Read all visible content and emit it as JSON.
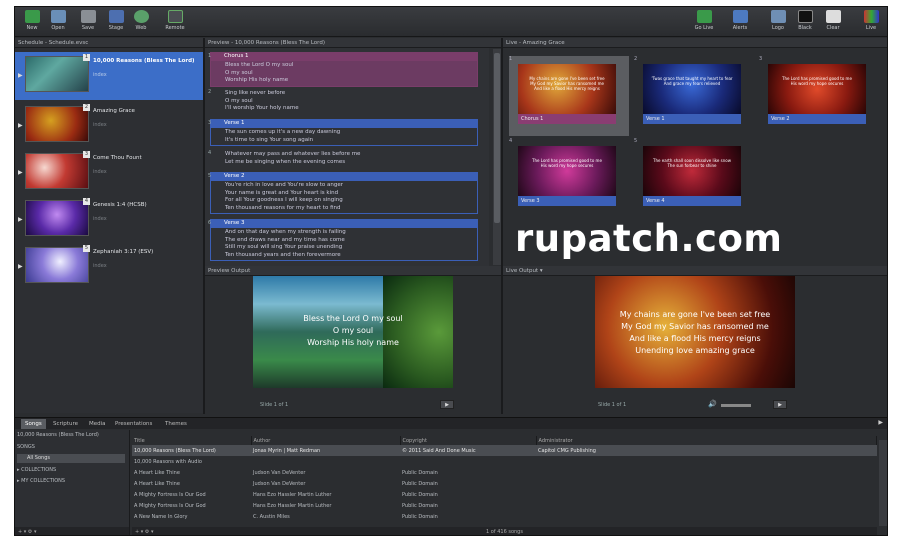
{
  "toolbar": {
    "buttons": [
      {
        "label": "New",
        "icon": "new-icon"
      },
      {
        "label": "Open",
        "icon": "open-icon"
      },
      {
        "label": "Save",
        "icon": "save-icon"
      },
      {
        "label": "Stage",
        "icon": "stage-icon"
      },
      {
        "label": "Web",
        "icon": "web-icon"
      },
      {
        "label": "Remote",
        "icon": "remote-icon"
      }
    ],
    "right": [
      {
        "label": "Go Live",
        "icon": "go-live-icon"
      },
      {
        "label": "Alerts",
        "icon": "alerts-icon"
      },
      {
        "label": "Logo",
        "icon": "logo-icon"
      },
      {
        "label": "Black",
        "icon": "black-icon"
      },
      {
        "label": "Clear",
        "icon": "clear-icon"
      },
      {
        "label": "Live",
        "icon": "live-icon"
      }
    ]
  },
  "schedule": {
    "header": "Schedule - Schedule.evsc",
    "items": [
      {
        "title": "10,000 Reasons (Bless The Lord)",
        "sub": "index",
        "num": "1"
      },
      {
        "title": "Amazing Grace",
        "sub": "index",
        "num": "2"
      },
      {
        "title": "Come Thou Fount",
        "sub": "index",
        "num": "3"
      },
      {
        "title": "Genesis 1:4 (HCSB)",
        "sub": "index",
        "num": "4"
      },
      {
        "title": "Zephaniah 3:17 (ESV)",
        "sub": "index",
        "num": "5"
      }
    ]
  },
  "preview": {
    "header": "Preview - 10,000 Reasons (Bless The Lord)",
    "slides": [
      {
        "num": "1",
        "title": "Chorus 1",
        "lines": [
          "Bless the Lord O my soul",
          "O my soul",
          "Worship His holy name"
        ]
      },
      {
        "num": "2",
        "title": "",
        "lines": [
          "Sing like never before",
          "O my soul",
          "I'll worship Your holy name"
        ]
      },
      {
        "num": "3",
        "title": "Verse 1",
        "lines": [
          "The sun comes up it's a new day dawning",
          "It's time to sing Your song again"
        ]
      },
      {
        "num": "4",
        "title": "",
        "lines": [
          "Whatever may pass and whatever lies before me",
          "Let me be singing when the evening comes"
        ]
      },
      {
        "num": "5",
        "title": "Verse 2",
        "lines": [
          "You're rich in love and You're slow to anger",
          "Your name is great and Your heart is kind",
          "For all Your goodness I will keep on singing",
          "Ten thousand reasons for my heart to find"
        ]
      },
      {
        "num": "6",
        "title": "Verse 3",
        "lines": [
          "And on that day when my strength is failing",
          "The end draws near and my time has come",
          "Still my soul will sing Your praise unending",
          "Ten thousand years and then forevermore"
        ]
      }
    ]
  },
  "live": {
    "header": "Live - Amazing Grace",
    "cells": [
      {
        "n": "1",
        "label": "Chorus 1"
      },
      {
        "n": "2",
        "label": "Verse 1"
      },
      {
        "n": "3",
        "label": "Verse 2"
      },
      {
        "n": "4",
        "label": "Verse 3"
      },
      {
        "n": "5",
        "label": "Verse 4"
      }
    ]
  },
  "preview_output": {
    "header": "Preview Output",
    "lines": [
      "Bless the Lord O my soul",
      "O my soul",
      "Worship His holy name"
    ],
    "slide_of": "Slide 1 of 1"
  },
  "live_output": {
    "header": "Live Output",
    "lines": [
      "My chains are gone I've been set free",
      "My God my Savior has ransomed me",
      "And like a flood His mercy reigns",
      "Unending love amazing grace"
    ],
    "slide_of": "Slide 1 of 1"
  },
  "watermark": "rupatch.com",
  "tabs": [
    "Songs",
    "Scripture",
    "Media",
    "Presentations",
    "Themes"
  ],
  "library": {
    "left": {
      "selected": "10,000 Reasons (Bless The Lord)",
      "section": "SONGS",
      "all": "All Songs",
      "collections": "COLLECTIONS",
      "my_collections": "MY COLLECTIONS"
    },
    "columns": [
      "Title",
      "Author",
      "Copyright",
      "Administrator"
    ],
    "rows": [
      [
        "10,000 Reasons (Bless The Lord)",
        "Jonas Myrin | Matt Redman",
        "© 2011 Said And Done Music",
        "Capitol CMG Publishing"
      ],
      [
        "10,000 Reasons with Audio",
        "",
        "",
        ""
      ],
      [
        "A Heart Like Thine",
        "Judson Van DeVenter",
        "Public Domain",
        ""
      ],
      [
        "A Heart Like Thine",
        "Judson Van DeVenter",
        "Public Domain",
        ""
      ],
      [
        "A Mighty Fortress Is Our God",
        "Hans Ezo Hassler Martin Luther",
        "Public Domain",
        ""
      ],
      [
        "A Mighty Fortress Is Our God",
        "Hans Ezo Hassler Martin Luther",
        "Public Domain",
        ""
      ],
      [
        "A New Name In Glory",
        "C. Austin Miles",
        "Public Domain",
        ""
      ]
    ],
    "footer": "1 of 416 songs"
  }
}
